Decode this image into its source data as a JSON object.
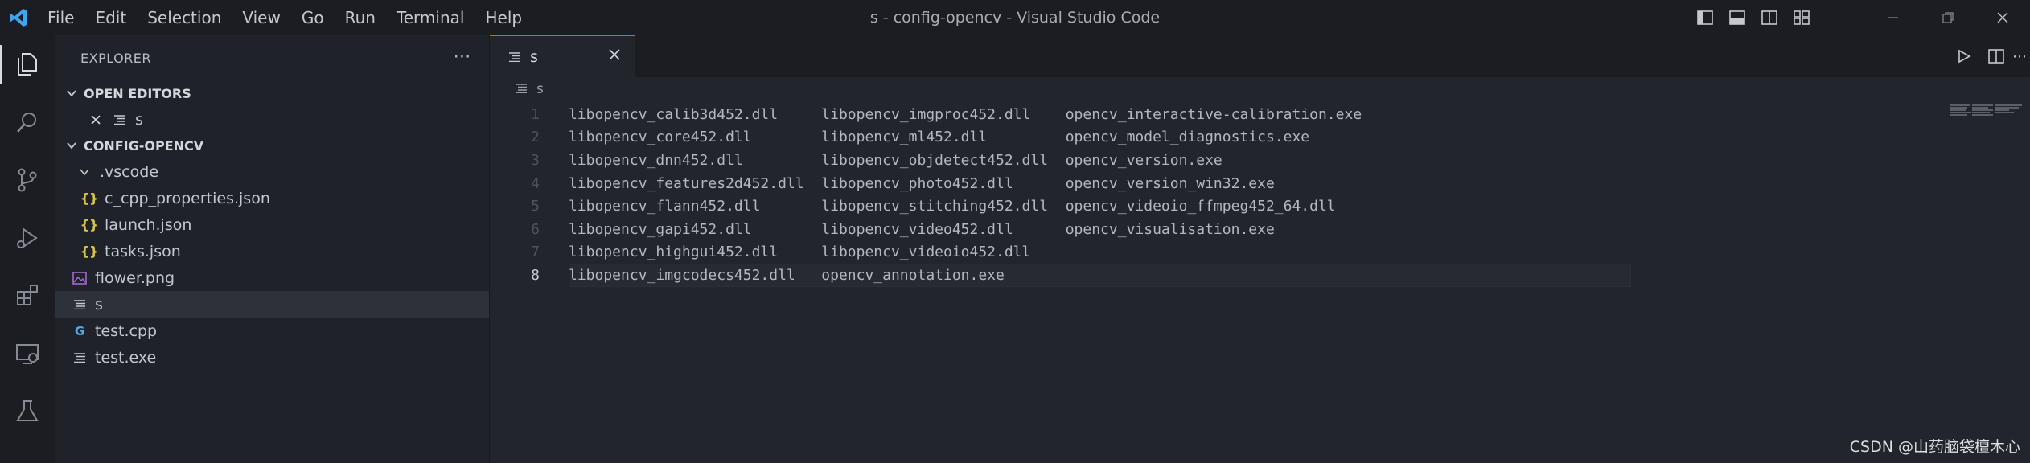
{
  "window": {
    "title": "s - config-opencv - Visual Studio Code"
  },
  "menu": [
    "File",
    "Edit",
    "Selection",
    "View",
    "Go",
    "Run",
    "Terminal",
    "Help"
  ],
  "sidebar": {
    "header": "EXPLORER",
    "open_editors": {
      "label": "OPEN EDITORS",
      "items": [
        {
          "name": "s"
        }
      ]
    },
    "folder": {
      "label": "CONFIG-OPENCV",
      "vscode_folder": ".vscode",
      "vscode_files": [
        "c_cpp_properties.json",
        "launch.json",
        "tasks.json"
      ],
      "files": [
        "flower.png",
        "s",
        "test.cpp",
        "test.exe"
      ]
    }
  },
  "editor": {
    "tab_label": "s",
    "breadcrumb": "s",
    "current_line": 8,
    "lines": [
      {
        "n": "1",
        "t": "libopencv_calib3d452.dll     libopencv_imgproc452.dll    opencv_interactive-calibration.exe"
      },
      {
        "n": "2",
        "t": "libopencv_core452.dll        libopencv_ml452.dll         opencv_model_diagnostics.exe"
      },
      {
        "n": "3",
        "t": "libopencv_dnn452.dll         libopencv_objdetect452.dll  opencv_version.exe"
      },
      {
        "n": "4",
        "t": "libopencv_features2d452.dll  libopencv_photo452.dll      opencv_version_win32.exe"
      },
      {
        "n": "5",
        "t": "libopencv_flann452.dll       libopencv_stitching452.dll  opencv_videoio_ffmpeg452_64.dll"
      },
      {
        "n": "6",
        "t": "libopencv_gapi452.dll        libopencv_video452.dll      opencv_visualisation.exe"
      },
      {
        "n": "7",
        "t": "libopencv_highgui452.dll     libopencv_videoio452.dll"
      },
      {
        "n": "8",
        "t": "libopencv_imgcodecs452.dll   opencv_annotation.exe"
      }
    ]
  },
  "watermark": "CSDN @山药脑袋檀木心",
  "colors": {
    "accent": "#3c8cd8",
    "vscode_logo": "#3ea6f0",
    "json_icon": "#d8c24a",
    "cpp_icon": "#56a8e8",
    "png_icon": "#a06ad0"
  }
}
